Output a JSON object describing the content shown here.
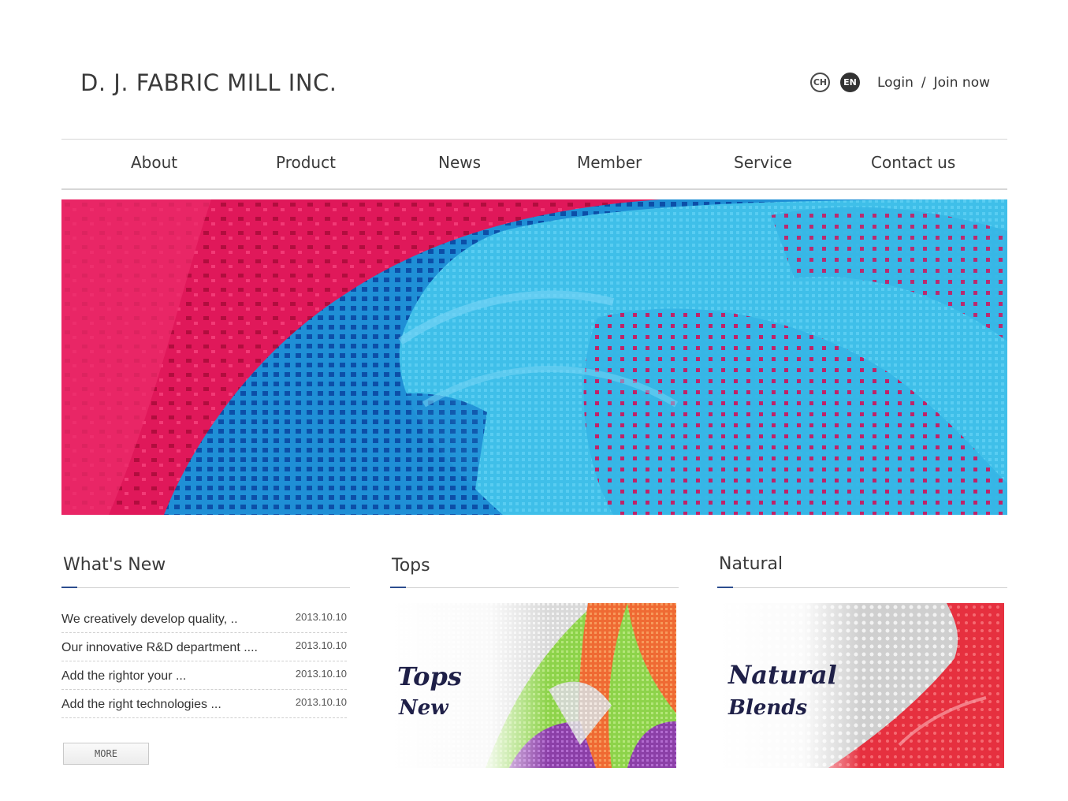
{
  "header": {
    "logo": "D. J. FABRIC MILL INC.",
    "lang_ch": "CH",
    "lang_en": "EN",
    "login": "Login",
    "separator": "/",
    "join": "Join now"
  },
  "nav": [
    "About",
    "Product",
    "News",
    "Member",
    "Service",
    "Contact us"
  ],
  "whats_new": {
    "title": "What's New",
    "items": [
      {
        "text": "We creatively develop quality, ..",
        "date": "2013.10.10"
      },
      {
        "text": "Our innovative R&D department ....",
        "date": "2013.10.10"
      },
      {
        "text": "Add the rightor your ...",
        "date": "2013.10.10"
      },
      {
        "text": "Add the right technologies ...",
        "date": "2013.10.10"
      }
    ],
    "more": "MORE"
  },
  "tops": {
    "title": "Tops",
    "line1": "Tops",
    "line2": "New"
  },
  "natural": {
    "title": "Natural",
    "line1": "Natural",
    "line2": "Blends"
  },
  "colors": {
    "accent": "#2c4d8f",
    "pink": "#e3195c",
    "blue": "#25a8dd"
  }
}
